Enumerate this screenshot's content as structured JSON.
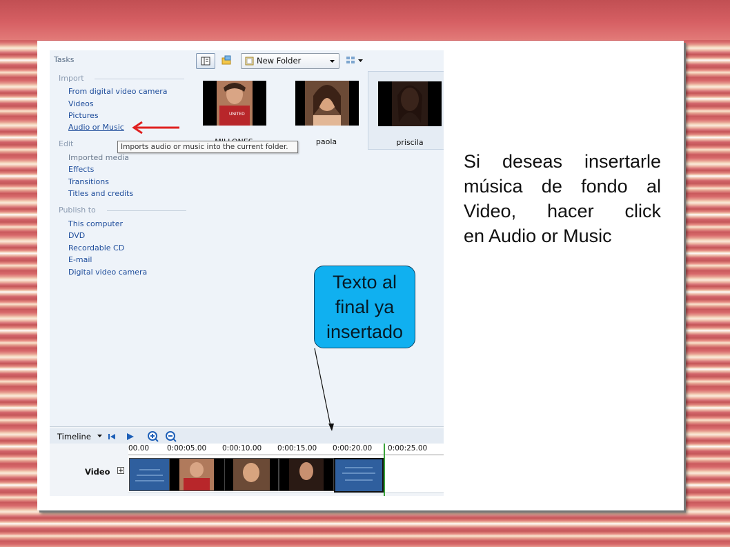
{
  "tasks": {
    "title": "Tasks",
    "import": {
      "heading": "Import",
      "items": [
        "From digital video camera",
        "Videos",
        "Pictures",
        "Audio or Music"
      ]
    },
    "edit": {
      "heading": "Edit",
      "items": [
        "Imported media",
        "Effects",
        "Transitions",
        "Titles and credits"
      ]
    },
    "publish": {
      "heading": "Publish to",
      "items": [
        "This computer",
        "DVD",
        "Recordable CD",
        "E-mail",
        "Digital video camera"
      ]
    }
  },
  "tooltip": "Imports audio or music into the current folder.",
  "toolbar": {
    "folder": "New Folder"
  },
  "thumbnails": [
    "MILLONES",
    "paola",
    "priscila"
  ],
  "timeline": {
    "label": "Timeline",
    "ticks": [
      "00.00",
      "0:00:05.00",
      "0:00:10.00",
      "0:00:15.00",
      "0:00:20.00",
      "0:00:25.00"
    ],
    "track_label": "Video"
  },
  "instruction": [
    "Si deseas insertarle",
    "música de fondo al",
    "Video, hacer click",
    "en Audio or Music"
  ],
  "bubble": [
    "Texto al",
    "final ya",
    "insertado"
  ],
  "colors": {
    "link": "#1c4b9a",
    "arrow": "#e02020",
    "bubble": "#10b0f0",
    "playhead": "#3aa33a"
  }
}
